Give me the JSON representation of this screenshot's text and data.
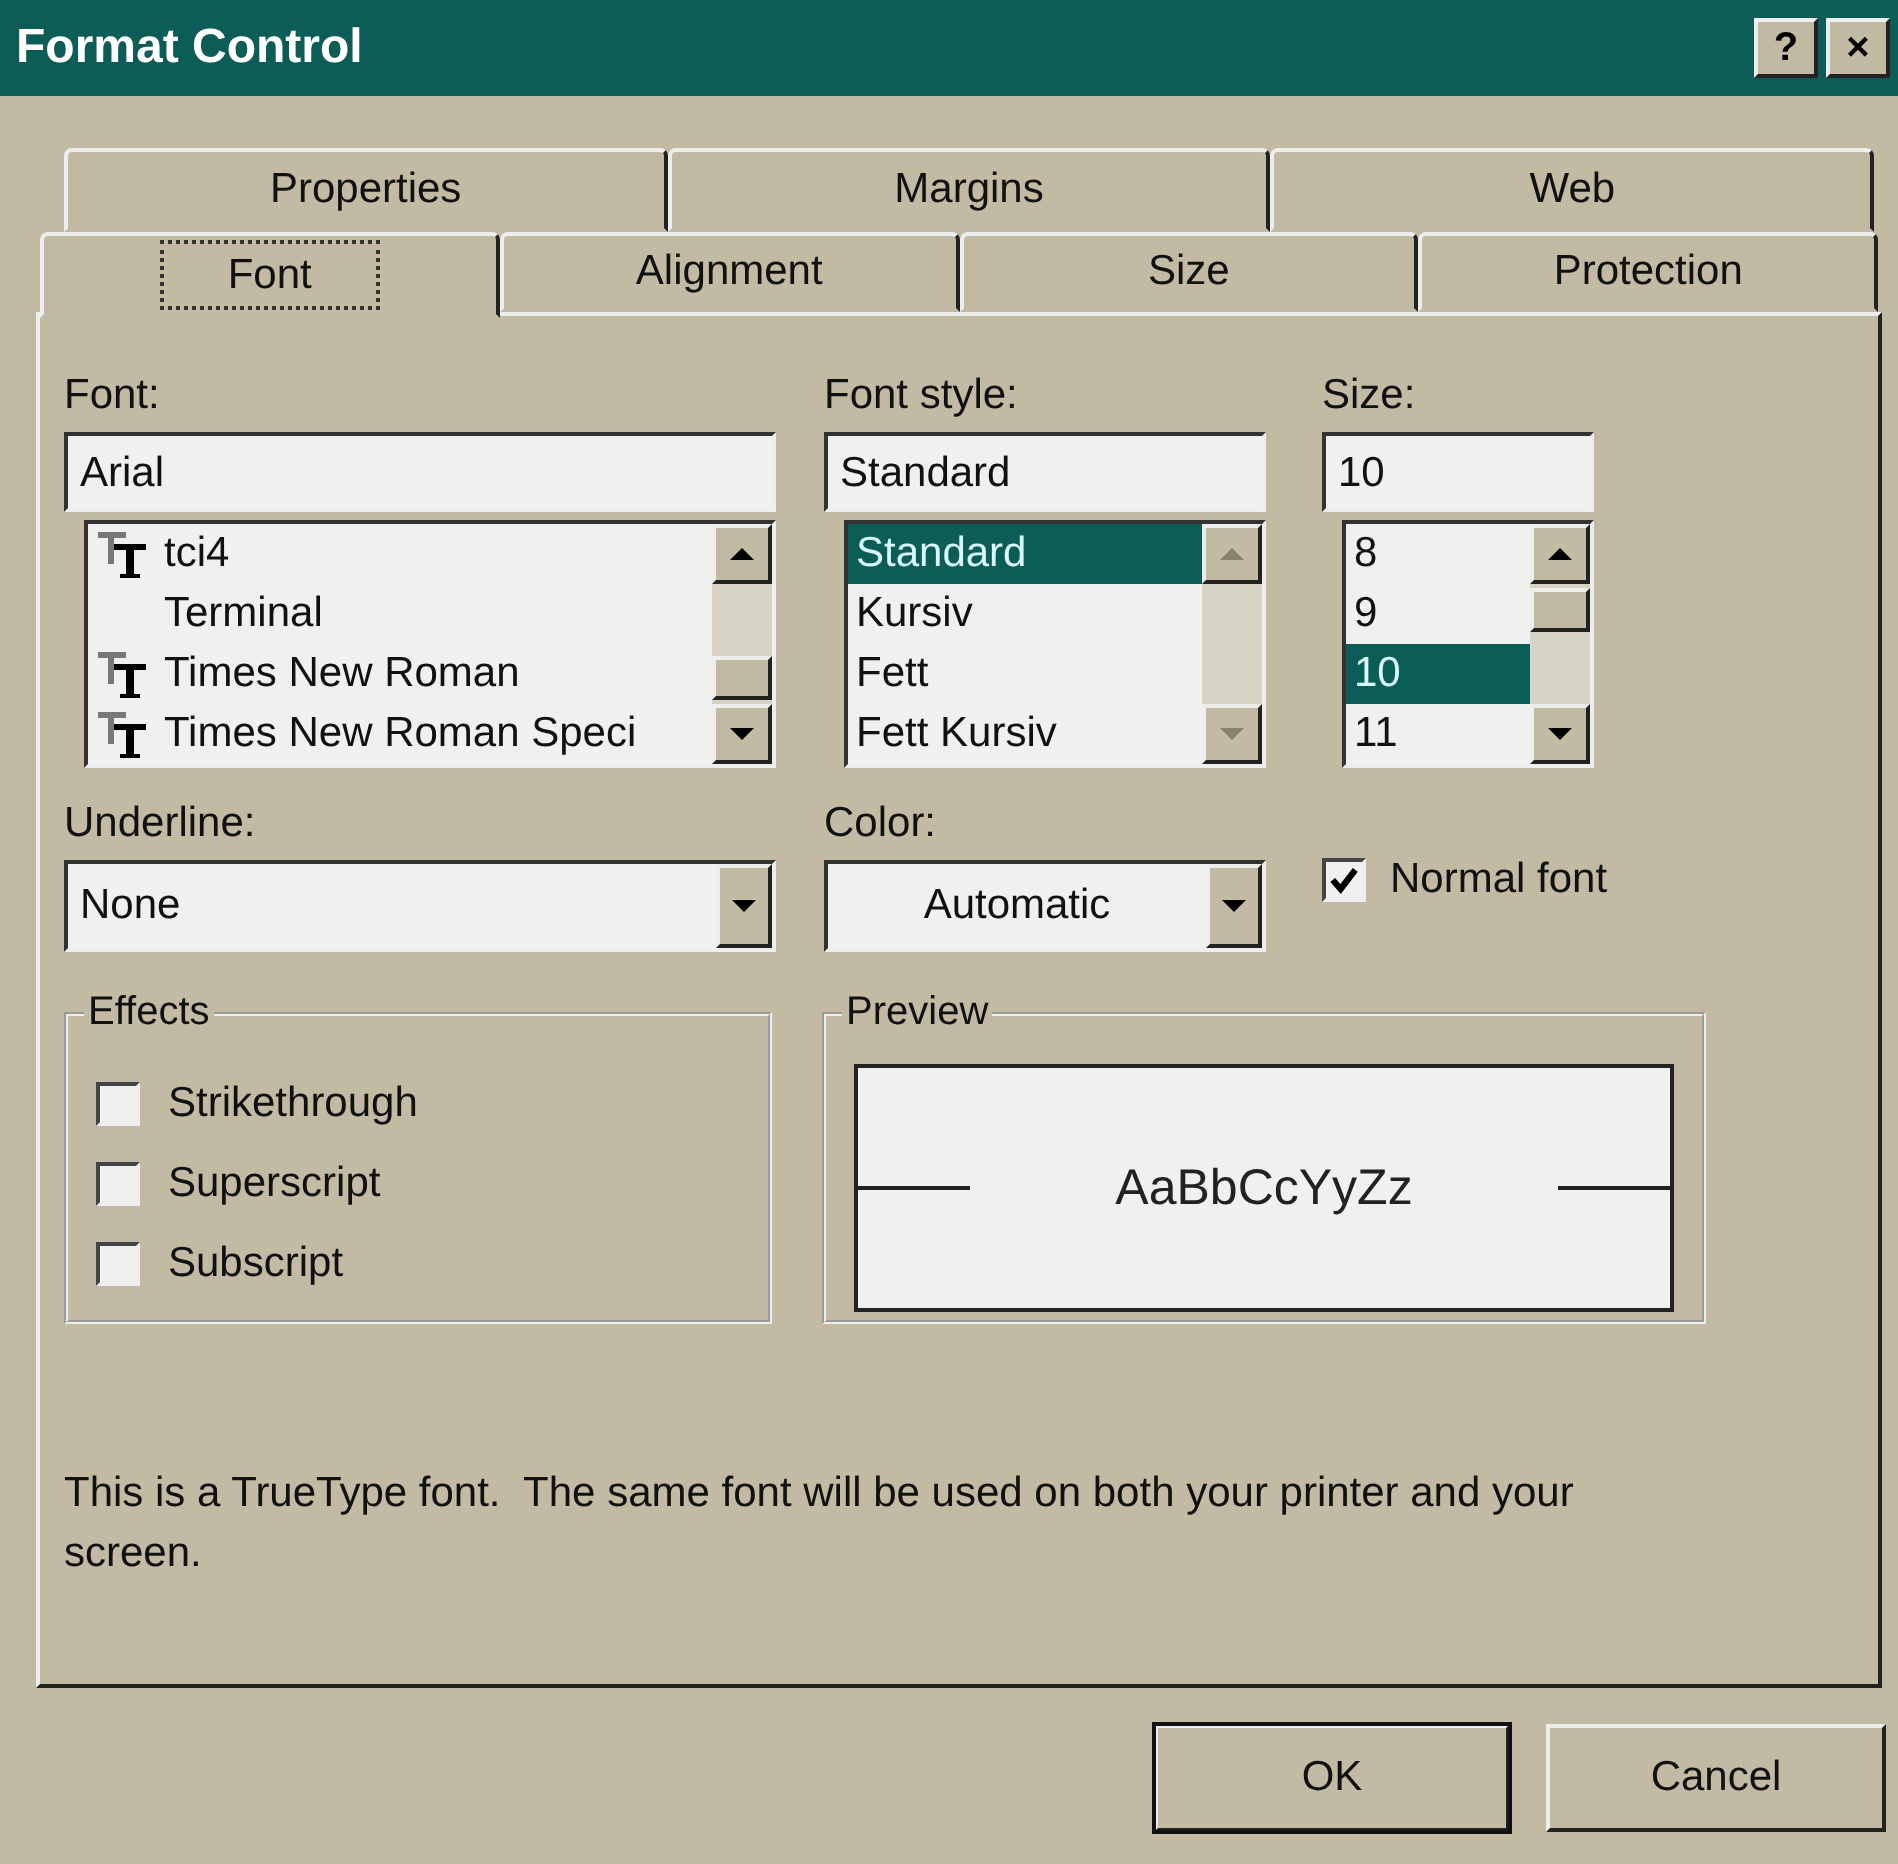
{
  "window": {
    "title": "Format Control",
    "title_buttons": [
      "?",
      "×"
    ]
  },
  "tab_rows": [
    [
      {
        "label": "Properties",
        "selected": false
      },
      {
        "label": "Margins",
        "selected": false
      },
      {
        "label": "Web",
        "selected": false
      }
    ],
    [
      {
        "label": "Font",
        "selected": true
      },
      {
        "label": "Alignment",
        "selected": false
      },
      {
        "label": "Size",
        "selected": false
      },
      {
        "label": "Protection",
        "selected": false
      }
    ]
  ],
  "font": {
    "label": "Font:",
    "value": "Arial",
    "scrollbar_disabled": false,
    "items": [
      {
        "label": "tci4",
        "truetype": true,
        "selected": false
      },
      {
        "label": "Terminal",
        "truetype": false,
        "selected": false
      },
      {
        "label": "Times New Roman",
        "truetype": true,
        "selected": false
      },
      {
        "label": "Times New Roman Speci",
        "truetype": true,
        "selected": false
      }
    ]
  },
  "font_style": {
    "label": "Font style:",
    "value": "Standard",
    "scrollbar_disabled": true,
    "items": [
      {
        "label": "Standard",
        "selected": true
      },
      {
        "label": "Kursiv",
        "selected": false
      },
      {
        "label": "Fett",
        "selected": false
      },
      {
        "label": "Fett Kursiv",
        "selected": false
      }
    ]
  },
  "size": {
    "label": "Size:",
    "value": "10",
    "scrollbar_disabled": false,
    "items": [
      {
        "label": "8",
        "selected": false
      },
      {
        "label": "9",
        "selected": false
      },
      {
        "label": "10",
        "selected": true
      },
      {
        "label": "11",
        "selected": false
      }
    ]
  },
  "underline": {
    "label": "Underline:",
    "value": "None"
  },
  "color": {
    "label": "Color:",
    "value": "Automatic"
  },
  "normal_font": {
    "label": "Normal font",
    "checked": true
  },
  "effects": {
    "title": "Effects",
    "options": [
      {
        "label": "Strikethrough",
        "checked": false
      },
      {
        "label": "Superscript",
        "checked": false
      },
      {
        "label": "Subscript",
        "checked": false
      }
    ]
  },
  "preview": {
    "title": "Preview",
    "sample": "AaBbCcYyZz"
  },
  "description": "This is a TrueType font.  The same font will be used on both your printer and your screen.",
  "buttons": [
    {
      "label": "OK",
      "default": true
    },
    {
      "label": "Cancel",
      "default": false
    }
  ]
}
